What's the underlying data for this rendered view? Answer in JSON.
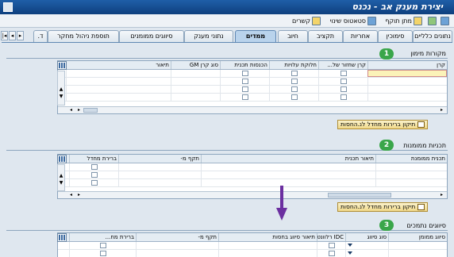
{
  "window": {
    "title": "יצירת מענק אב - נכנס"
  },
  "toolbar": {
    "items": [
      {
        "label": "",
        "icon": "save-icon"
      },
      {
        "label": "",
        "icon": "create-icon"
      },
      {
        "label": "מתן תוקף",
        "icon": "validate-icon"
      },
      {
        "label": "סטאטוס שינוי",
        "icon": "status-icon"
      },
      {
        "label": "קשרים",
        "icon": "relationships-icon"
      }
    ]
  },
  "tabs": [
    {
      "label": "נתונים כלליים",
      "active": false
    },
    {
      "label": "סימוכין",
      "active": false
    },
    {
      "label": "אחריות",
      "active": false
    },
    {
      "label": "תקציב",
      "active": false
    },
    {
      "label": "חיוב",
      "active": false
    },
    {
      "label": "ממדים",
      "active": true
    },
    {
      "label": "נתוני מענק",
      "active": false
    },
    {
      "label": "סיווגים ממומנים",
      "active": false
    },
    {
      "label": "תוספת ניהול מחקר",
      "active": false
    },
    {
      "label": "ד.",
      "active": false
    }
  ],
  "sections": {
    "funding_sources": {
      "title": "מקורות מימון",
      "badge": "1",
      "columns": [
        "קרן",
        "קרן שחזור של...",
        "חלוקת עלויות",
        "הכנסות תכנית",
        "סוג קרן GM",
        "תיאור"
      ],
      "button_label": "תיקון ברירות מחדל לנ.החסות"
    },
    "sponsored_programs": {
      "title": "תכניות ממומנות",
      "badge": "2",
      "columns": [
        "תכנית ממומנת",
        "תיאור תכנית",
        "תקף מ-",
        "ברירת מחדל"
      ],
      "button_label": "תיקון ברירות מחדל לנ.החסות"
    },
    "sponsored_classes": {
      "title": "סיווגים נתמכים",
      "badge": "3",
      "columns": [
        "סיווג ממומן",
        "סוג סיווג",
        "IDC רלוונטי",
        "תיאור סיווג בחסות",
        "תקף מ-",
        "ברירת מח..."
      ]
    }
  },
  "colors": {
    "title_bar": "#1f5fa8",
    "badge": "#3aa64a",
    "arrow": "#6b2fa0",
    "button": "#f1d98a"
  }
}
